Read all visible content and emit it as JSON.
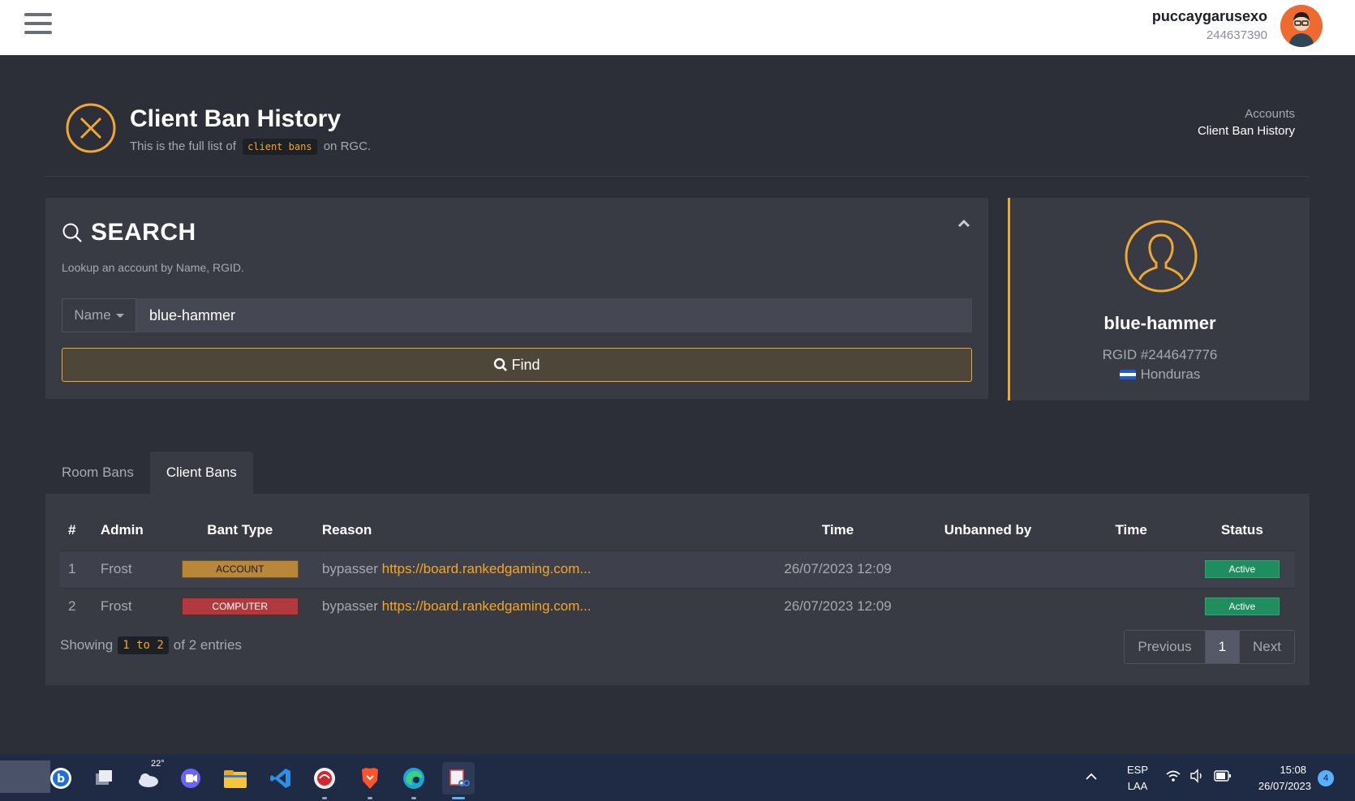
{
  "user": {
    "name": "puccaygarusexo",
    "id": "244637390"
  },
  "header": {
    "title": "Client Ban History",
    "subtitle_prefix": "This is the full list of",
    "subtitle_code": "client bans",
    "subtitle_suffix": "on RGC.",
    "breadcrumb": [
      "Accounts",
      "Client Ban History"
    ]
  },
  "search": {
    "title": "SEARCH",
    "hint": "Lookup an account by Name, RGID.",
    "select_value": "Name",
    "input_value": "blue-hammer",
    "find_label": "Find"
  },
  "profile": {
    "name": "blue-hammer",
    "rgid": "RGID #244647776",
    "country": "Honduras"
  },
  "tabs": [
    {
      "label": "Room Bans",
      "active": false
    },
    {
      "label": "Client Bans",
      "active": true
    }
  ],
  "table": {
    "headers": [
      "#",
      "Admin",
      "Bant Type",
      "Reason",
      "Time",
      "Unbanned by",
      "Time",
      "Status"
    ],
    "rows": [
      {
        "num": "1",
        "admin": "Frost",
        "type": "ACCOUNT",
        "reason_text": "bypasser",
        "reason_link": "https://board.rankedgaming.com...",
        "time": "26/07/2023 12:09",
        "unbanned_by": "",
        "unban_time": "",
        "status": "Active"
      },
      {
        "num": "2",
        "admin": "Frost",
        "type": "COMPUTER",
        "reason_text": "bypasser",
        "reason_link": "https://board.rankedgaming.com...",
        "time": "26/07/2023 12:09",
        "unbanned_by": "",
        "unban_time": "",
        "status": "Active"
      }
    ],
    "showing_prefix": "Showing",
    "showing_range": "1 to 2",
    "showing_suffix": "of 2 entries"
  },
  "pager": {
    "previous": "Previous",
    "current": "1",
    "next": "Next"
  },
  "taskbar": {
    "weather_temp": "22°",
    "lang_1": "ESP",
    "lang_2": "LAA",
    "time": "15:08",
    "date": "26/07/2023",
    "notifications": "4"
  },
  "colors": {
    "accent": "#f0a830",
    "background": "#2d2f38",
    "panel": "#383a44",
    "status_active": "#1f8e5f",
    "badge_account": "#b9873a",
    "badge_computer": "#b23a3f"
  }
}
